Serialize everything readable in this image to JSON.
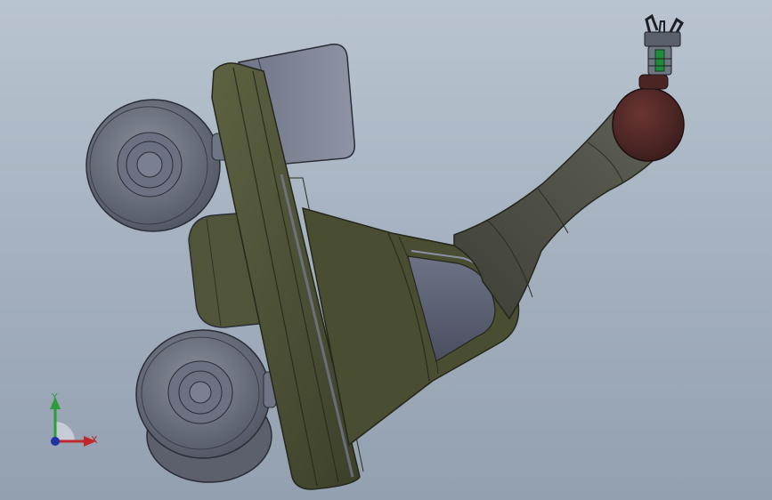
{
  "viewport": {
    "background_top": "#b9c4d0",
    "background_bottom": "#93a0b0"
  },
  "model": {
    "body_color": "#4e5236",
    "wheel_color": "#6d7280",
    "arm_color": "#4b4d43",
    "head_color": "#4e2826",
    "gripper_accent_color": "#1f8a3c"
  },
  "triad": {
    "x_label": "X",
    "y_label": "Y",
    "x_color": "#c0272d",
    "y_color": "#2e9b3c",
    "z_color": "#1f2fa8"
  }
}
